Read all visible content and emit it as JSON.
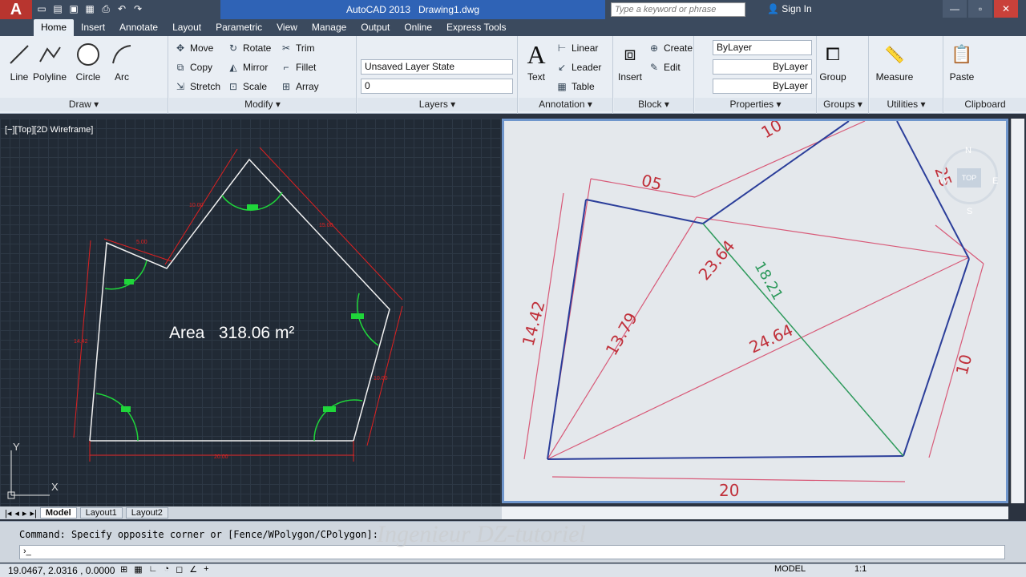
{
  "titlebar": {
    "app": "AutoCAD 2013",
    "file": "Drawing1.dwg",
    "search_placeholder": "Type a keyword or phrase",
    "signin": "Sign In"
  },
  "tabs": [
    "Home",
    "Insert",
    "Annotate",
    "Layout",
    "Parametric",
    "View",
    "Manage",
    "Output",
    "Online",
    "Express Tools"
  ],
  "ribbon": {
    "draw": {
      "title": "Draw",
      "line": "Line",
      "polyline": "Polyline",
      "circle": "Circle",
      "arc": "Arc"
    },
    "modify": {
      "title": "Modify",
      "move": "Move",
      "rotate": "Rotate",
      "trim": "Trim",
      "copy": "Copy",
      "mirror": "Mirror",
      "fillet": "Fillet",
      "stretch": "Stretch",
      "scale": "Scale",
      "array": "Array"
    },
    "layers": {
      "title": "Layers",
      "state": "Unsaved Layer State",
      "current": "0"
    },
    "annotation": {
      "title": "Annotation",
      "text": "Text",
      "linear": "Linear",
      "leader": "Leader",
      "table": "Table"
    },
    "block": {
      "title": "Block",
      "insert": "Insert",
      "create": "Create",
      "edit": "Edit"
    },
    "properties": {
      "title": "Properties",
      "color": "ByLayer",
      "linetype": "ByLayer",
      "lineweight": "ByLayer"
    },
    "groups": {
      "title": "Groups",
      "group": "Group"
    },
    "utilities": {
      "title": "Utilities",
      "measure": "Measure"
    },
    "clipboard": {
      "title": "Clipboard",
      "paste": "Paste"
    }
  },
  "viewport": {
    "label": "[−][Top][2D Wireframe]",
    "area_label": "Area",
    "area_value": "318.06 m²",
    "dims": {
      "d1": "10.00",
      "d2": "5.00",
      "d3": "15.00",
      "d4": "14.42",
      "d5": "10.00",
      "d6": "20.00"
    }
  },
  "sketch": {
    "t10": "10",
    "t05": "05",
    "t25": "25",
    "t1442": "14.42",
    "t1379": "13.79",
    "t2364": "23.64",
    "t1821": "18.21",
    "t2464": "24.64",
    "t10b": "10",
    "t20": "20"
  },
  "viewcube": {
    "n": "N",
    "w": "W",
    "e": "E",
    "s": "S",
    "top": "TOP"
  },
  "layout_tabs": [
    "Model",
    "Layout1",
    "Layout2"
  ],
  "command": {
    "text": "Command: Specify opposite corner or [Fence/WPolygon/CPolygon]:",
    "prompt": "›_"
  },
  "status": {
    "coords": "19.0467, 2.0316 , 0.0000",
    "model": "MODEL",
    "scale": "1:1"
  },
  "watermark": "Ingenieur DZ-tutoriel"
}
